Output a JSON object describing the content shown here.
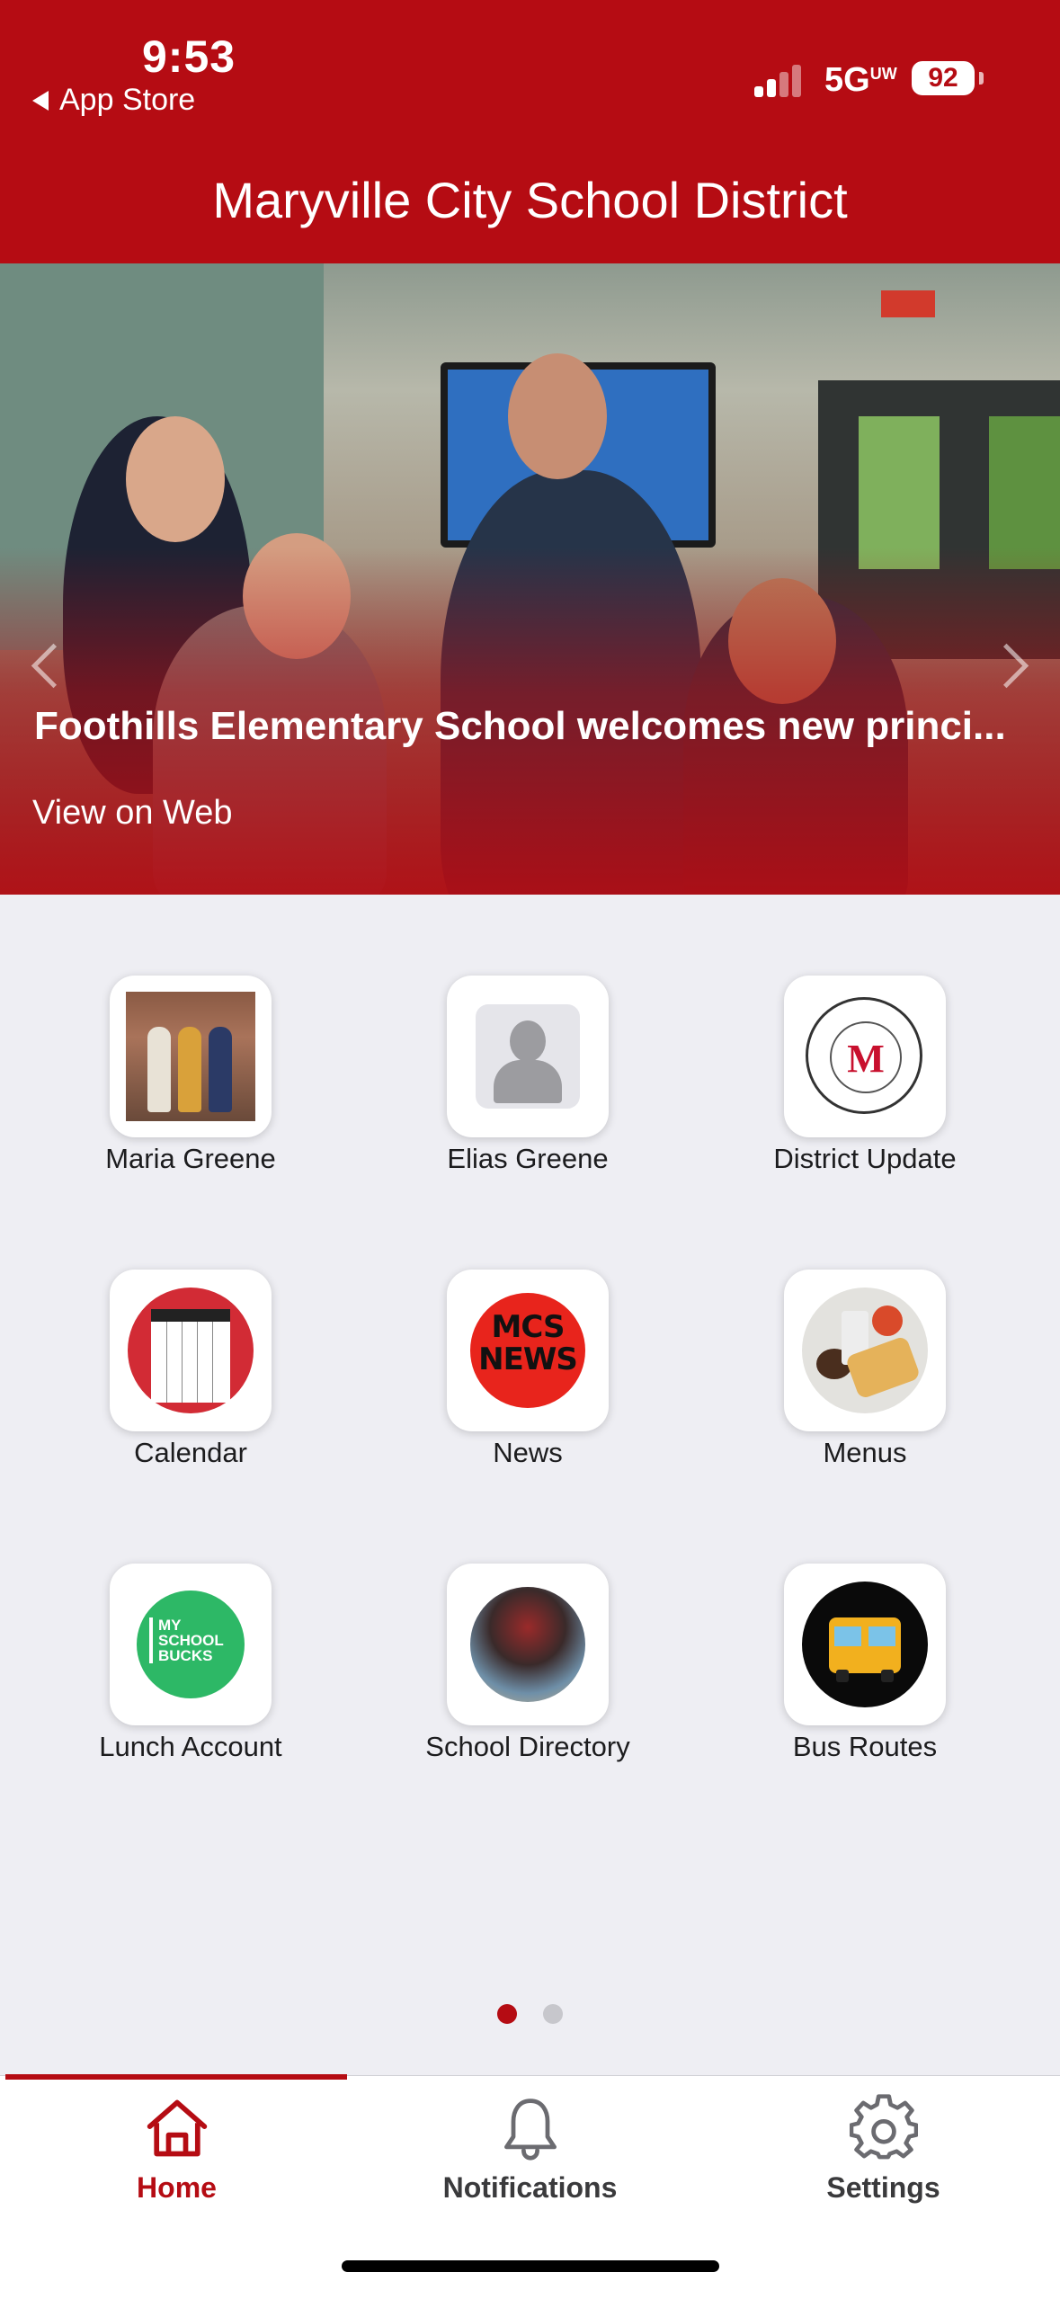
{
  "status_bar": {
    "time": "9:53",
    "back_label": "App Store",
    "network": "5G",
    "network_suffix": "UW",
    "battery": "92"
  },
  "header": {
    "title": "Maryville City School District"
  },
  "hero": {
    "headline": "Foothills Elementary School welcomes new princi...",
    "link_label": "View on Web"
  },
  "tiles": [
    {
      "label": "Maria Greene",
      "icon": "profile-photo"
    },
    {
      "label": "Elias Greene",
      "icon": "avatar-placeholder"
    },
    {
      "label": "District Update",
      "icon": "district-seal"
    },
    {
      "label": "Calendar",
      "icon": "calendar"
    },
    {
      "label": "News",
      "icon": "news",
      "icon_text": "MCS NEWS"
    },
    {
      "label": "Menus",
      "icon": "food"
    },
    {
      "label": "Lunch Account",
      "icon": "my-school-bucks",
      "icon_text": "MY SCHOOL BUCKS"
    },
    {
      "label": "School Directory",
      "icon": "group-photo"
    },
    {
      "label": "Bus Routes",
      "icon": "school-bus"
    }
  ],
  "pager": {
    "pages": 2,
    "current": 1
  },
  "tabbar": {
    "tabs": [
      {
        "label": "Home",
        "icon": "house-icon",
        "active": true
      },
      {
        "label": "Notifications",
        "icon": "bell-icon",
        "active": false
      },
      {
        "label": "Settings",
        "icon": "gear-icon",
        "active": false
      }
    ]
  },
  "colors": {
    "brand_red": "#B50C13",
    "background": "#EEEEF3",
    "inactive_dot": "#C7C7CC"
  }
}
